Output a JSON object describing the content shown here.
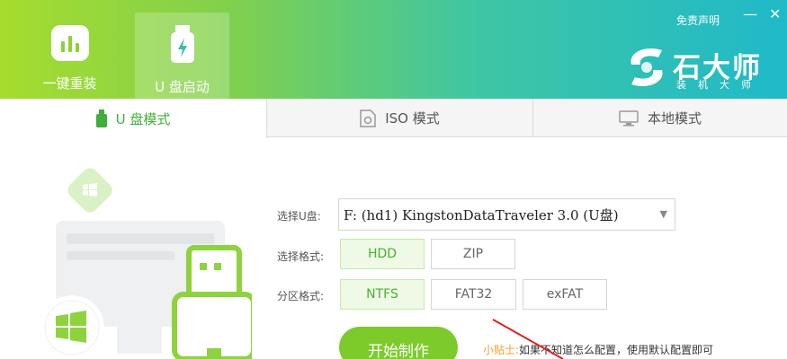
{
  "header": {
    "tabs": [
      {
        "label": "一键重装",
        "icon": "chart-icon"
      },
      {
        "label": "U 盘启动",
        "icon": "usb-lightning-icon"
      }
    ],
    "disclaimer": "免责声明",
    "minimize": "—",
    "close": "✕",
    "brand": {
      "name": "石大师",
      "subtitle": "装机大师"
    }
  },
  "modes": [
    {
      "label": "U 盘模式",
      "icon": "usb-icon",
      "active": true
    },
    {
      "label": "ISO 模式",
      "icon": "iso-file-icon",
      "active": false
    },
    {
      "label": "本地模式",
      "icon": "monitor-icon",
      "active": false
    }
  ],
  "form": {
    "usb_label": "选择U盘:",
    "usb_value": "F: (hd1) KingstonDataTraveler 3.0 (U盘)",
    "format_label": "选择格式:",
    "formats": [
      "HDD",
      "ZIP"
    ],
    "format_selected": "HDD",
    "partition_label": "分区格式:",
    "partitions": [
      "NTFS",
      "FAT32",
      "exFAT"
    ],
    "partition_selected": "NTFS",
    "start_button": "开始制作",
    "tip_head": "小贴士:",
    "tip_body": "如果不知道怎么配置，使用默认配置即可"
  },
  "colors": {
    "accent": "#7ccb2b",
    "active_text": "#3fae3a",
    "tip_head": "#f59d2a"
  }
}
